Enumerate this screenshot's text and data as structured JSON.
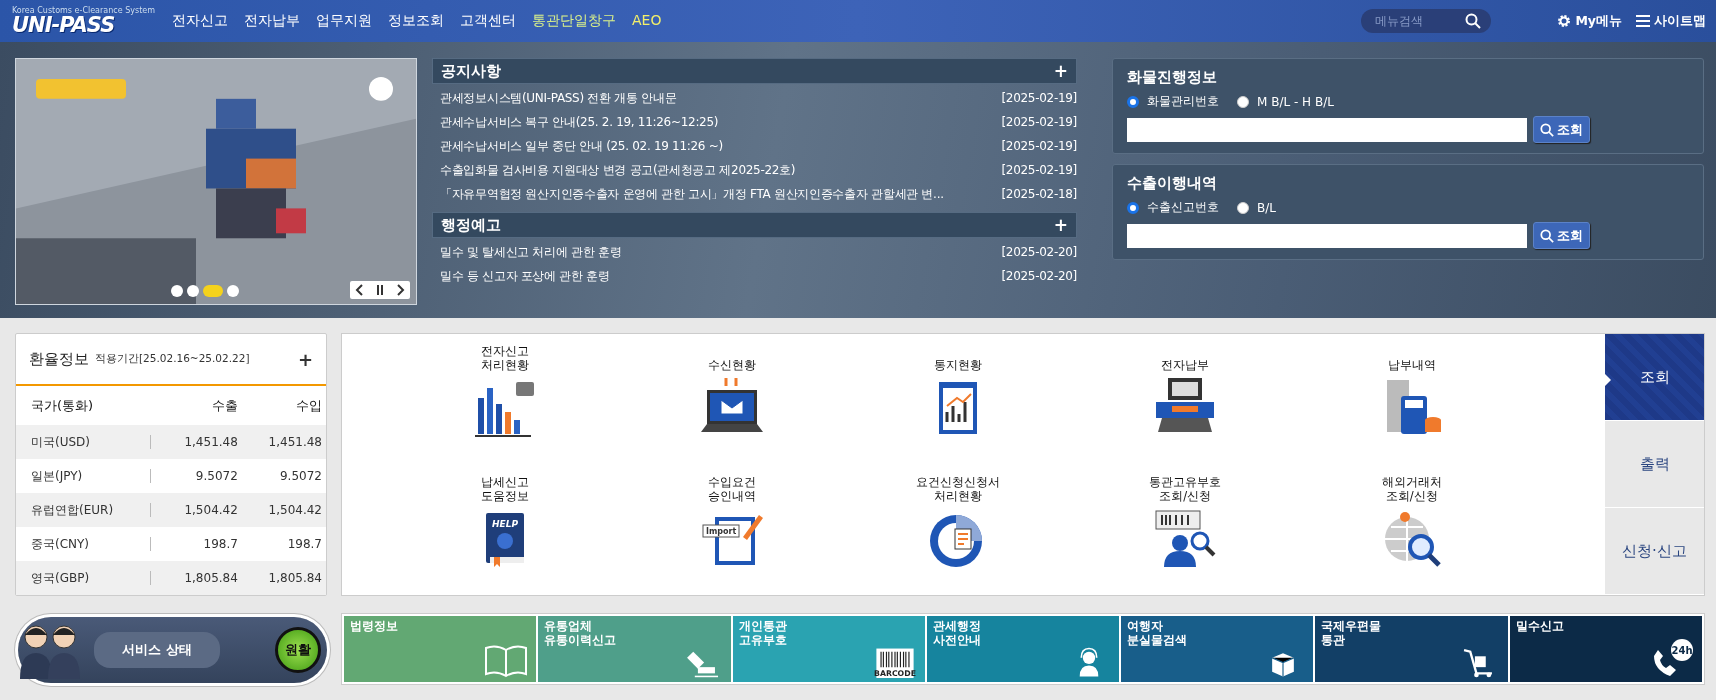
{
  "header": {
    "logo": "UNI-PASS",
    "tagline": "Korea Customs e-Clearance System",
    "nav": [
      {
        "label": "전자신고",
        "color": "#ffffff"
      },
      {
        "label": "전자납부",
        "color": "#ffffff"
      },
      {
        "label": "업무지원",
        "color": "#ffffff"
      },
      {
        "label": "정보조회",
        "color": "#ffffff"
      },
      {
        "label": "고객센터",
        "color": "#ffffff"
      },
      {
        "label": "통관단일창구",
        "color": "#d9f08a"
      },
      {
        "label": "AEO",
        "color": "#f3ef6a"
      }
    ],
    "search": {
      "placeholder": "메뉴검색"
    },
    "my_menu": "My메뉴",
    "sitemap": "사이트맵"
  },
  "banner": {
    "kind": "picture",
    "slides": [
      {
        "selected": false
      },
      {
        "selected": false
      },
      {
        "selected": true
      },
      {
        "selected": false
      }
    ]
  },
  "notices": {
    "title": "공지사항",
    "more": "+",
    "items": [
      {
        "text": "관세정보시스템(UNI-PASS) 전환 개통 안내문",
        "date": "[2025-02-19]"
      },
      {
        "text": "관세수납서비스 복구 안내(25. 2. 19, 11:26~12:25)",
        "date": "[2025-02-19]"
      },
      {
        "text": "관세수납서비스 일부 중단 안내 (25. 02. 19 11:26 ~)",
        "date": "[2025-02-19]"
      },
      {
        "text": "수출입화물 검사비용 지원대상 변경 공고(관세청공고 제2025-22호)",
        "date": "[2025-02-19]"
      },
      {
        "text": "「자유무역협정 원산지인증수출자 운영에 관한 고시」개정 FTA 원산지인증수출자 관할세관 변...",
        "date": "[2025-02-18]"
      }
    ]
  },
  "admin_notices": {
    "title": "행정예고",
    "more": "+",
    "items": [
      {
        "text": "밀수 및 탈세신고 처리에 관한 훈령",
        "date": "[2025-02-20]"
      },
      {
        "text": "밀수 등 신고자 포상에 관한 훈령",
        "date": "[2025-02-20]"
      }
    ]
  },
  "lookups": [
    {
      "title": "화물진행정보",
      "options": [
        {
          "label": "화물관리번호",
          "selected": true
        },
        {
          "label": "M B/L - H B/L",
          "selected": false
        }
      ],
      "button": "조회"
    },
    {
      "title": "수출이행내역",
      "options": [
        {
          "label": "수출신고번호",
          "selected": true
        },
        {
          "label": "B/L",
          "selected": false
        }
      ],
      "button": "조회"
    }
  ],
  "exchange": {
    "title": "환율정보",
    "period": "적용기간[25.02.16~25.02.22]",
    "more": "+",
    "columns": [
      "국가(통화)",
      "수출",
      "수입"
    ],
    "rows": [
      [
        "미국(USD)",
        "1,451.48",
        "1,451.48"
      ],
      [
        "일본(JPY)",
        "9.5072",
        "9.5072"
      ],
      [
        "유럽연합(EUR)",
        "1,504.42",
        "1,504.42"
      ],
      [
        "중국(CNY)",
        "198.7",
        "198.7"
      ],
      [
        "영국(GBP)",
        "1,805.84",
        "1,805.84"
      ]
    ]
  },
  "services": [
    {
      "label": "전자신고\n처리현황"
    },
    {
      "label": "수신현황"
    },
    {
      "label": "통지현황"
    },
    {
      "label": "전자납부"
    },
    {
      "label": "납부내역"
    },
    {
      "label": "납세신고\n도움정보",
      "icon_text": "HELP"
    },
    {
      "label": "수입요건\n승인내역",
      "icon_text": "Import"
    },
    {
      "label": "요건신청신청서\n처리현황"
    },
    {
      "label": "통관고유부호\n조회/신청"
    },
    {
      "label": "해외거래처\n조회/신청"
    }
  ],
  "side_tabs": [
    {
      "label": "조회",
      "selected": true
    },
    {
      "label": "출력",
      "selected": false
    },
    {
      "label": "신청·신고",
      "selected": false
    }
  ],
  "service_status": {
    "label": "서비스 상태",
    "status": "원활"
  },
  "quick_links": [
    {
      "label": "법령정보",
      "color": "#62a873"
    },
    {
      "label": "유통업체\n유통이력신고",
      "color": "#4f9f8a"
    },
    {
      "label": "개인통관\n고유부호",
      "color": "#2aa3b1",
      "icon_text": "BARCODE"
    },
    {
      "label": "관세행정\n사전안내",
      "color": "#16849e"
    },
    {
      "label": "여행자\n분실물검색",
      "color": "#185e8a"
    },
    {
      "label": "국제우편물\n통관",
      "color": "#123f66"
    },
    {
      "label": "밀수신고",
      "color": "#0c2a47",
      "icon_text": "24h"
    }
  ]
}
